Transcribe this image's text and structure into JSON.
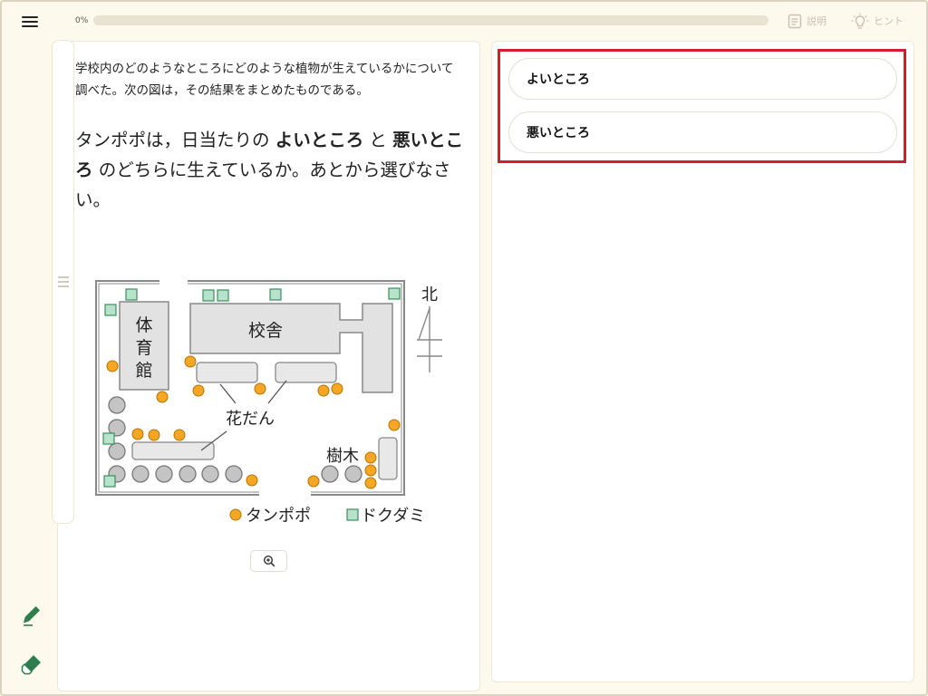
{
  "header": {
    "progress_label": "0%",
    "progress_value": 0,
    "explain_label": "説明",
    "hint_label": "ヒント"
  },
  "tools": {
    "pen_icon": "pencil-icon",
    "eraser_icon": "eraser-icon"
  },
  "problem": {
    "intro": "学校内のどのようなところにどのような植物が生えているかについて調べた。次の図は，その結果をまとめたものである。",
    "question_pre": "タンポポは，日当たりの ",
    "option_a": "よいところ",
    "question_mid": " と ",
    "option_b": "悪いところ",
    "question_post": " のどちらに生えているか。あとから選びなさい。"
  },
  "map": {
    "gym_label": [
      "体",
      "育",
      "館"
    ],
    "school_label": "校舎",
    "flowerbed_label": "花だん",
    "trees_label": "樹木",
    "north_label": "北",
    "legend_dandelion": "タンポポ",
    "legend_dokudami": "ドクダミ"
  },
  "choices": [
    {
      "label": "よいところ"
    },
    {
      "label": "悪いところ"
    }
  ],
  "colors": {
    "accent_green": "#3a8f5a",
    "highlight_red": "#d41e27",
    "dandelion": "#f5a623",
    "dokudami": "#b7e3cd"
  }
}
